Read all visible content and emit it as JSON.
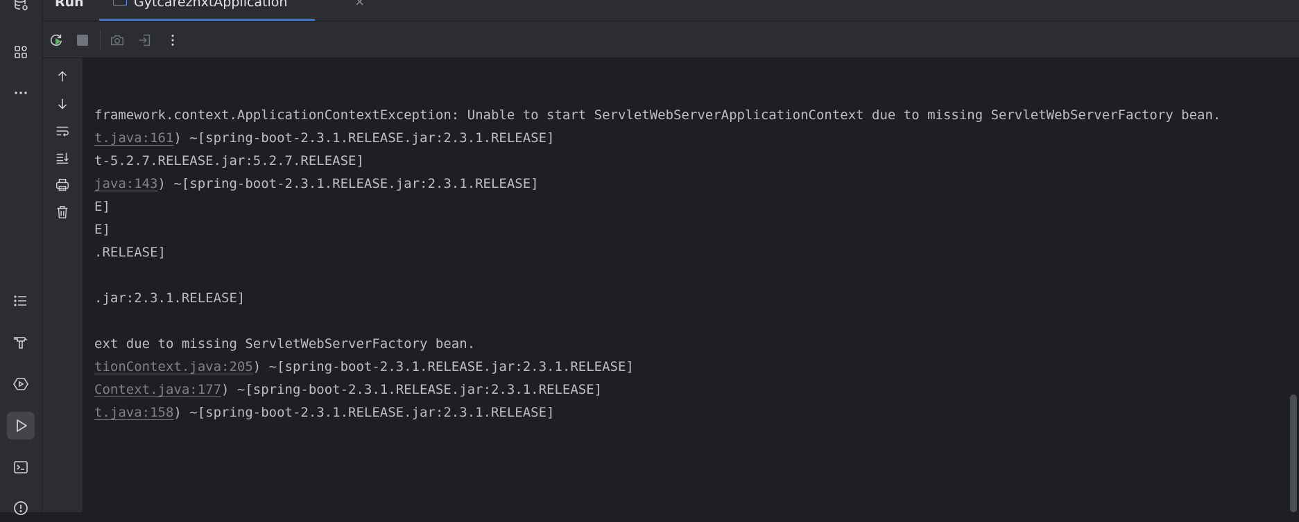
{
  "run_panel": {
    "title": "Run",
    "tab": {
      "label": "GytcareznxtApplication",
      "close_glyph": "×",
      "icon": "application-icon"
    }
  },
  "activity_bar": [
    {
      "name": "database-icon"
    },
    {
      "name": "structure-icon"
    },
    {
      "name": "more-icon"
    },
    {
      "name": "todo-icon"
    },
    {
      "name": "build-icon"
    },
    {
      "name": "services-icon"
    },
    {
      "name": "run-icon",
      "active": true
    },
    {
      "name": "terminal-icon"
    },
    {
      "name": "problems-icon"
    }
  ],
  "toolbar": {
    "buttons": [
      "rerun-icon",
      "stop-icon",
      "screenshot-icon",
      "attach-debugger-icon",
      "more-actions-icon"
    ],
    "rerun_color": "#5fb865"
  },
  "side_toolbar": {
    "buttons": [
      "up-arrow-icon",
      "down-arrow-icon",
      "soft-wrap-icon",
      "scroll-to-end-icon",
      "print-icon",
      "clear-all-icon"
    ]
  },
  "console": {
    "lines": [
      {
        "segments": []
      },
      {
        "segments": []
      },
      {
        "segments": [
          {
            "text": "framework.context.ApplicationContextException: Unable to start ServletWebServerApplicationContext due to missing ServletWebServerFactory bean.",
            "link": false
          }
        ]
      },
      {
        "segments": [
          {
            "text": "t.java:161",
            "link": true
          },
          {
            "text": ") ~[spring-boot-2.3.1.RELEASE.jar:2.3.1.RELEASE]",
            "link": false
          }
        ]
      },
      {
        "segments": [
          {
            "text": "t-5.2.7.RELEASE.jar:5.2.7.RELEASE]",
            "link": false
          }
        ]
      },
      {
        "segments": [
          {
            "text": "java:143",
            "link": true
          },
          {
            "text": ") ~[spring-boot-2.3.1.RELEASE.jar:2.3.1.RELEASE]",
            "link": false
          }
        ]
      },
      {
        "segments": [
          {
            "text": "E]",
            "link": false
          }
        ]
      },
      {
        "segments": [
          {
            "text": "E]",
            "link": false
          }
        ]
      },
      {
        "segments": [
          {
            "text": ".RELEASE]",
            "link": false
          }
        ]
      },
      {
        "segments": []
      },
      {
        "segments": [
          {
            "text": ".jar:2.3.1.RELEASE]",
            "link": false
          }
        ]
      },
      {
        "segments": []
      },
      {
        "segments": [
          {
            "text": "ext due to missing ServletWebServerFactory bean.",
            "link": false
          }
        ]
      },
      {
        "segments": [
          {
            "text": "tionContext.java:205",
            "link": true
          },
          {
            "text": ") ~[spring-boot-2.3.1.RELEASE.jar:2.3.1.RELEASE]",
            "link": false
          }
        ]
      },
      {
        "segments": [
          {
            "text": "Context.java:177",
            "link": true
          },
          {
            "text": ") ~[spring-boot-2.3.1.RELEASE.jar:2.3.1.RELEASE]",
            "link": false
          }
        ]
      },
      {
        "segments": [
          {
            "text": "t.java:158",
            "link": true
          },
          {
            "text": ") ~[spring-boot-2.3.1.RELEASE.jar:2.3.1.RELEASE]",
            "link": false
          }
        ]
      }
    ]
  }
}
